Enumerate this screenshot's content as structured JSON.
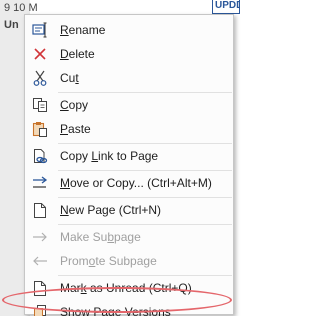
{
  "background": {
    "line1": "9 10 M",
    "line2": "Un",
    "corner": "UPDD"
  },
  "menu": {
    "items": [
      {
        "label": "Rename",
        "underline": 0,
        "icon": "rename-icon",
        "disabled": false
      },
      {
        "label": "Delete",
        "underline": 0,
        "icon": "delete-icon",
        "disabled": false
      },
      {
        "label": "Cut",
        "underline": 2,
        "icon": "cut-icon",
        "disabled": false
      },
      {
        "label": "Copy",
        "underline": 0,
        "icon": "copy-icon",
        "disabled": false
      },
      {
        "label": "Paste",
        "underline": 0,
        "icon": "paste-icon",
        "disabled": false
      },
      {
        "label": "Copy Link to Page",
        "underline": 5,
        "icon": "copy-link-icon",
        "disabled": false
      },
      {
        "label": "Move or Copy...  (Ctrl+Alt+M)",
        "underline": 0,
        "icon": "move-copy-icon",
        "disabled": false
      },
      {
        "label": "New Page  (Ctrl+N)",
        "underline": 0,
        "icon": "new-page-icon",
        "disabled": false
      },
      {
        "label": "Make Subpage",
        "underline": 7,
        "icon": "make-subpage-icon",
        "disabled": true
      },
      {
        "label": "Promote Subpage",
        "underline": 4,
        "icon": "promote-subpage-icon",
        "disabled": true
      },
      {
        "label": "Mark as Unread  (Ctrl+Q)",
        "underline": 3,
        "icon": "mark-unread-icon",
        "disabled": false
      },
      {
        "label": "Show Page Versions",
        "underline": 10,
        "icon": "page-versions-icon",
        "disabled": false
      }
    ]
  },
  "colors": {
    "highlight_ellipse": "#e4666b",
    "accent_blue": "#2b579a",
    "delete_red": "#d13438",
    "paste_orange": "#c8742c"
  }
}
